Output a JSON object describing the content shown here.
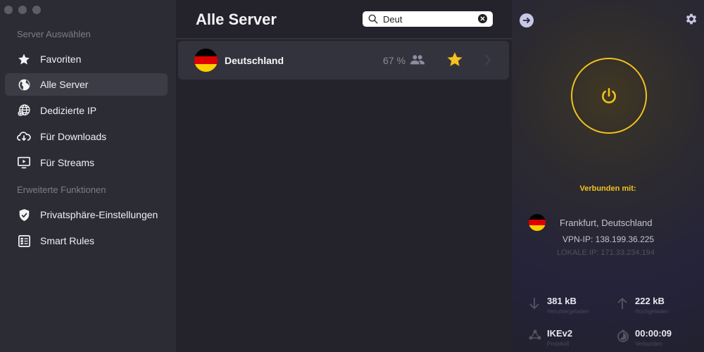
{
  "colors": {
    "accent": "#f1c21b",
    "sidebar_bg": "#2c2c35",
    "middle_bg": "#24232c",
    "row_bg": "#33333d"
  },
  "sidebar": {
    "section1": "Server Auswählen",
    "section2": "Erweiterte Funktionen",
    "items": [
      {
        "label": "Favoriten",
        "icon": "star-icon",
        "active": false
      },
      {
        "label": "Alle Server",
        "icon": "globe-icon",
        "active": true
      },
      {
        "label": "Dedizierte IP",
        "icon": "dedicated-ip-globe-icon",
        "active": false
      },
      {
        "label": "Für Downloads",
        "icon": "cloud-download-icon",
        "active": false
      },
      {
        "label": "Für Streams",
        "icon": "play-screen-icon",
        "active": false
      },
      {
        "label": "Privatsphäre-Einstellungen",
        "icon": "shield-check-icon",
        "active": false
      },
      {
        "label": "Smart Rules",
        "icon": "rules-list-icon",
        "active": false
      }
    ]
  },
  "main": {
    "title": "Alle Server",
    "search": {
      "value": "Deut",
      "placeholder": ""
    },
    "servers": [
      {
        "name": "Deutschland",
        "load": "67 %",
        "favorite": true,
        "flag": [
          "#000000",
          "#dd0000",
          "#ffce00"
        ]
      }
    ]
  },
  "status": {
    "connected_label": "Verbunden mit:",
    "location": "Frankfurt, Deutschland",
    "vpn_ip": "VPN-IP: 138.199.36.225",
    "local_ip": "LOKALE IP: 171.33.234.194",
    "stats": {
      "downloaded": {
        "value": "381 kB",
        "label": "Heruntergeladen"
      },
      "uploaded": {
        "value": "222 kB",
        "label": "Hochgeladen"
      },
      "protocol": {
        "value": "IKEv2",
        "label": "Protokoll"
      },
      "connected_time": {
        "value": "00:00:09",
        "label": "Verbunden"
      }
    }
  }
}
